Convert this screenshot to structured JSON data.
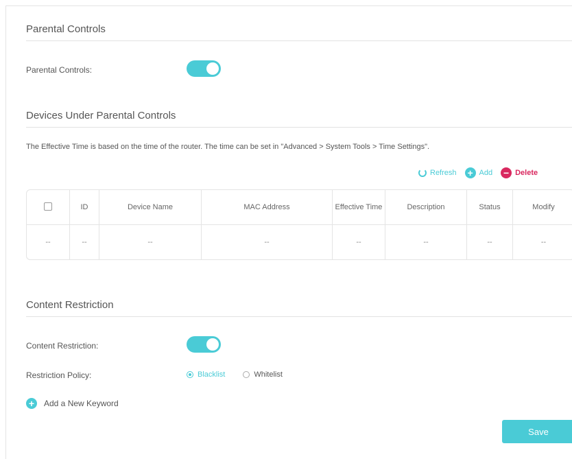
{
  "parental": {
    "section_title": "Parental Controls",
    "label": "Parental Controls:",
    "enabled": true
  },
  "devices": {
    "section_title": "Devices Under Parental Controls",
    "note": "The Effective Time is based on the time of the router. The time can be set in \"Advanced > System Tools > Time Settings\".",
    "toolbar": {
      "refresh": "Refresh",
      "add": "Add",
      "delete": "Delete"
    },
    "columns": [
      "ID",
      "Device Name",
      "MAC Address",
      "Effective Time",
      "Description",
      "Status",
      "Modify"
    ],
    "rows": [
      [
        "--",
        "--",
        "--",
        "--",
        "--",
        "--",
        "--",
        "--"
      ]
    ]
  },
  "content": {
    "section_title": "Content Restriction",
    "label": "Content Restriction:",
    "enabled": true,
    "policy_label": "Restriction Policy:",
    "policy_options": [
      "Blacklist",
      "Whitelist"
    ],
    "policy_selected": "Blacklist",
    "add_keyword": "Add a New Keyword"
  },
  "save_label": "Save",
  "colors": {
    "accent": "#4acbd6",
    "delete": "#d9285f"
  }
}
